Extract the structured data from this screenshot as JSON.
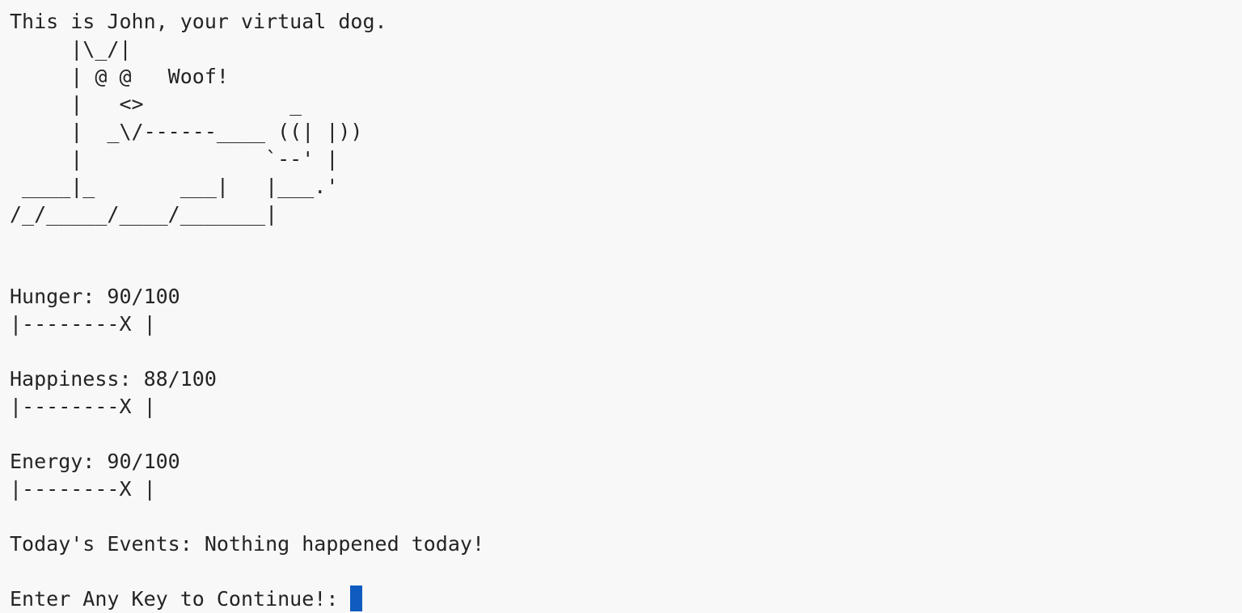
{
  "intro": "This is John, your virtual dog.",
  "dog_ascii": "     |\\_/|\n     | @ @   Woof!\n     |   <>            _\n     |  _\\/------____ ((| |))\n     |               `--' |\n ____|_       ___|   |___.'\n/_/_____/____/_______|",
  "stats": [
    {
      "label": "Hunger: 90/100",
      "bar": "|--------X |",
      "value": 90,
      "max": 100
    },
    {
      "label": "Happiness: 88/100",
      "bar": "|--------X |",
      "value": 88,
      "max": 100
    },
    {
      "label": "Energy: 90/100",
      "bar": "|--------X |",
      "value": 90,
      "max": 100
    }
  ],
  "events": "Today's Events: Nothing happened today!",
  "prompt": "Enter Any Key to Continue!: ",
  "cursor_color": "#0f5bbf"
}
